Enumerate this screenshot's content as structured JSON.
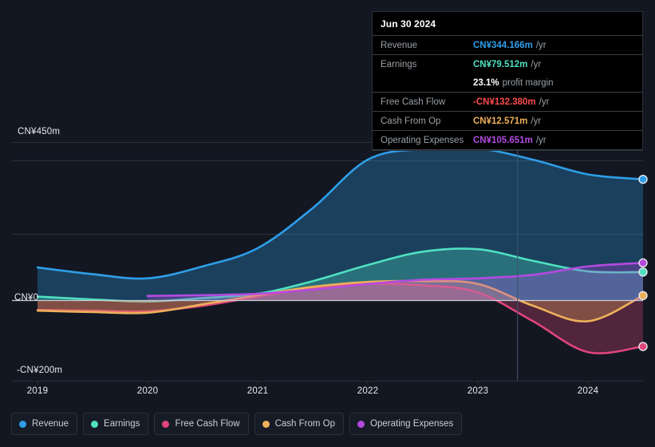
{
  "chart_data": {
    "type": "area",
    "title": "",
    "xlabel": "",
    "ylabel": "",
    "currency": "CN¥",
    "grid": true,
    "legend_position": "bottom",
    "ylim": [
      -200,
      450
    ],
    "y_ticks": [
      {
        "label": "CN¥450m",
        "value": 450
      },
      {
        "label": "CN¥0",
        "value": 0
      },
      {
        "label": "-CN¥200m",
        "value": -200
      }
    ],
    "x_ticks": [
      {
        "label": "2019",
        "value": 2019
      },
      {
        "label": "2020",
        "value": 2020
      },
      {
        "label": "2021",
        "value": 2021
      },
      {
        "label": "2022",
        "value": 2022
      },
      {
        "label": "2023",
        "value": 2023
      },
      {
        "label": "2024",
        "value": 2024
      }
    ],
    "x": [
      2019.0,
      2019.5,
      2020.0,
      2020.5,
      2021.0,
      2021.5,
      2022.0,
      2022.5,
      2023.0,
      2023.5,
      2024.0,
      2024.5
    ],
    "series": [
      {
        "name": "Revenue",
        "color": "#2e9ee8",
        "values": [
          93,
          74,
          62,
          96,
          148,
          262,
          400,
          430,
          432,
          400,
          358,
          344
        ]
      },
      {
        "name": "Earnings",
        "color": "#4fe0c0",
        "values": [
          10,
          2,
          -4,
          6,
          18,
          54,
          100,
          138,
          145,
          112,
          82,
          80
        ]
      },
      {
        "name": "Free Cash Flow",
        "color": "#e0457b",
        "values": [
          -28,
          -30,
          -32,
          -16,
          10,
          34,
          46,
          42,
          22,
          -60,
          -148,
          -132
        ]
      },
      {
        "name": "Cash From Op",
        "color": "#eeb05a",
        "values": [
          -30,
          -34,
          -36,
          -12,
          14,
          38,
          52,
          54,
          46,
          -16,
          -60,
          13
        ]
      },
      {
        "name": "Operating Expenses",
        "color": "#b44ae0",
        "values": [
          null,
          null,
          12,
          14,
          18,
          30,
          46,
          58,
          62,
          72,
          96,
          106
        ]
      }
    ],
    "forecast_divider_x": 2023.36
  },
  "tooltip": {
    "name": "data-tooltip",
    "title": "Jun 30 2024",
    "rows": [
      {
        "label": "Revenue",
        "value": "CN¥344.166m",
        "unit": "/yr",
        "color": "#2e9ee8",
        "separator": true
      },
      {
        "label": "Earnings",
        "value": "CN¥79.512m",
        "unit": "/yr",
        "color": "#4fe0c0",
        "separator": true
      },
      {
        "label": "",
        "value": "23.1%",
        "unit": "profit margin",
        "color": "#ffffff",
        "separator": false
      },
      {
        "label": "Free Cash Flow",
        "value": "-CN¥132.380m",
        "unit": "/yr",
        "color": "#ff4d4d",
        "separator": true
      },
      {
        "label": "Cash From Op",
        "value": "CN¥12.571m",
        "unit": "/yr",
        "color": "#eeb05a",
        "separator": true
      },
      {
        "label": "Operating Expenses",
        "value": "CN¥105.651m",
        "unit": "/yr",
        "color": "#b44ae0",
        "separator": true
      }
    ]
  },
  "legend": {
    "items": [
      {
        "label": "Revenue",
        "color": "#2e9ee8"
      },
      {
        "label": "Earnings",
        "color": "#4fe0c0"
      },
      {
        "label": "Free Cash Flow",
        "color": "#e0457b"
      },
      {
        "label": "Cash From Op",
        "color": "#eeb05a"
      },
      {
        "label": "Operating Expenses",
        "color": "#b44ae0"
      }
    ]
  },
  "colors": {
    "background": "#131722",
    "grid": "#2b3139",
    "zero_line": "#c8ccd4",
    "text": "#e8eaed",
    "muted_text": "#9aa0a6"
  }
}
